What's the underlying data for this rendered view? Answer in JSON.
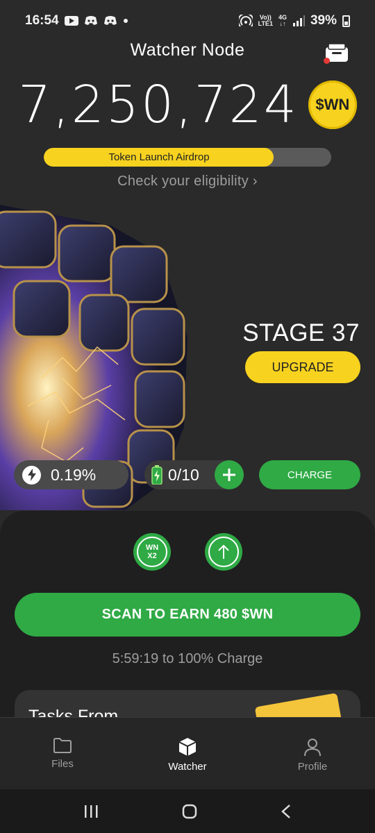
{
  "status_bar": {
    "time": "16:54",
    "network_top": "Vo))",
    "network_bottom": "LTE1",
    "data_type": "4G",
    "battery_percent": "39%"
  },
  "header": {
    "title": "Watcher Node",
    "balance": "7,250,724",
    "coin_label": "$WN"
  },
  "airdrop": {
    "label": "Token Launch Airdrop",
    "progress_fraction": 0.8,
    "eligibility_link": "Check your eligibility ›"
  },
  "stage": {
    "label": "STAGE 37",
    "upgrade_label": "UPGRADE"
  },
  "stats": {
    "rate": "0.19%",
    "batteries": "0/10",
    "charge_label": "CHARGE"
  },
  "boosts": {
    "multiplier_top": "WN",
    "multiplier_bottom": "X2"
  },
  "scan": {
    "button_label": "SCAN TO EARN 480 $WN",
    "timer": "5:59:19 to 100% Charge"
  },
  "tasks": {
    "title": "Tasks From"
  },
  "nav": {
    "items": [
      {
        "label": "Files",
        "icon": "folder-icon"
      },
      {
        "label": "Watcher",
        "icon": "cube-icon"
      },
      {
        "label": "Profile",
        "icon": "person-icon"
      }
    ]
  },
  "colors": {
    "accent_yellow": "#f7d21f",
    "accent_green": "#2faa45",
    "background": "#2a2a2a"
  }
}
